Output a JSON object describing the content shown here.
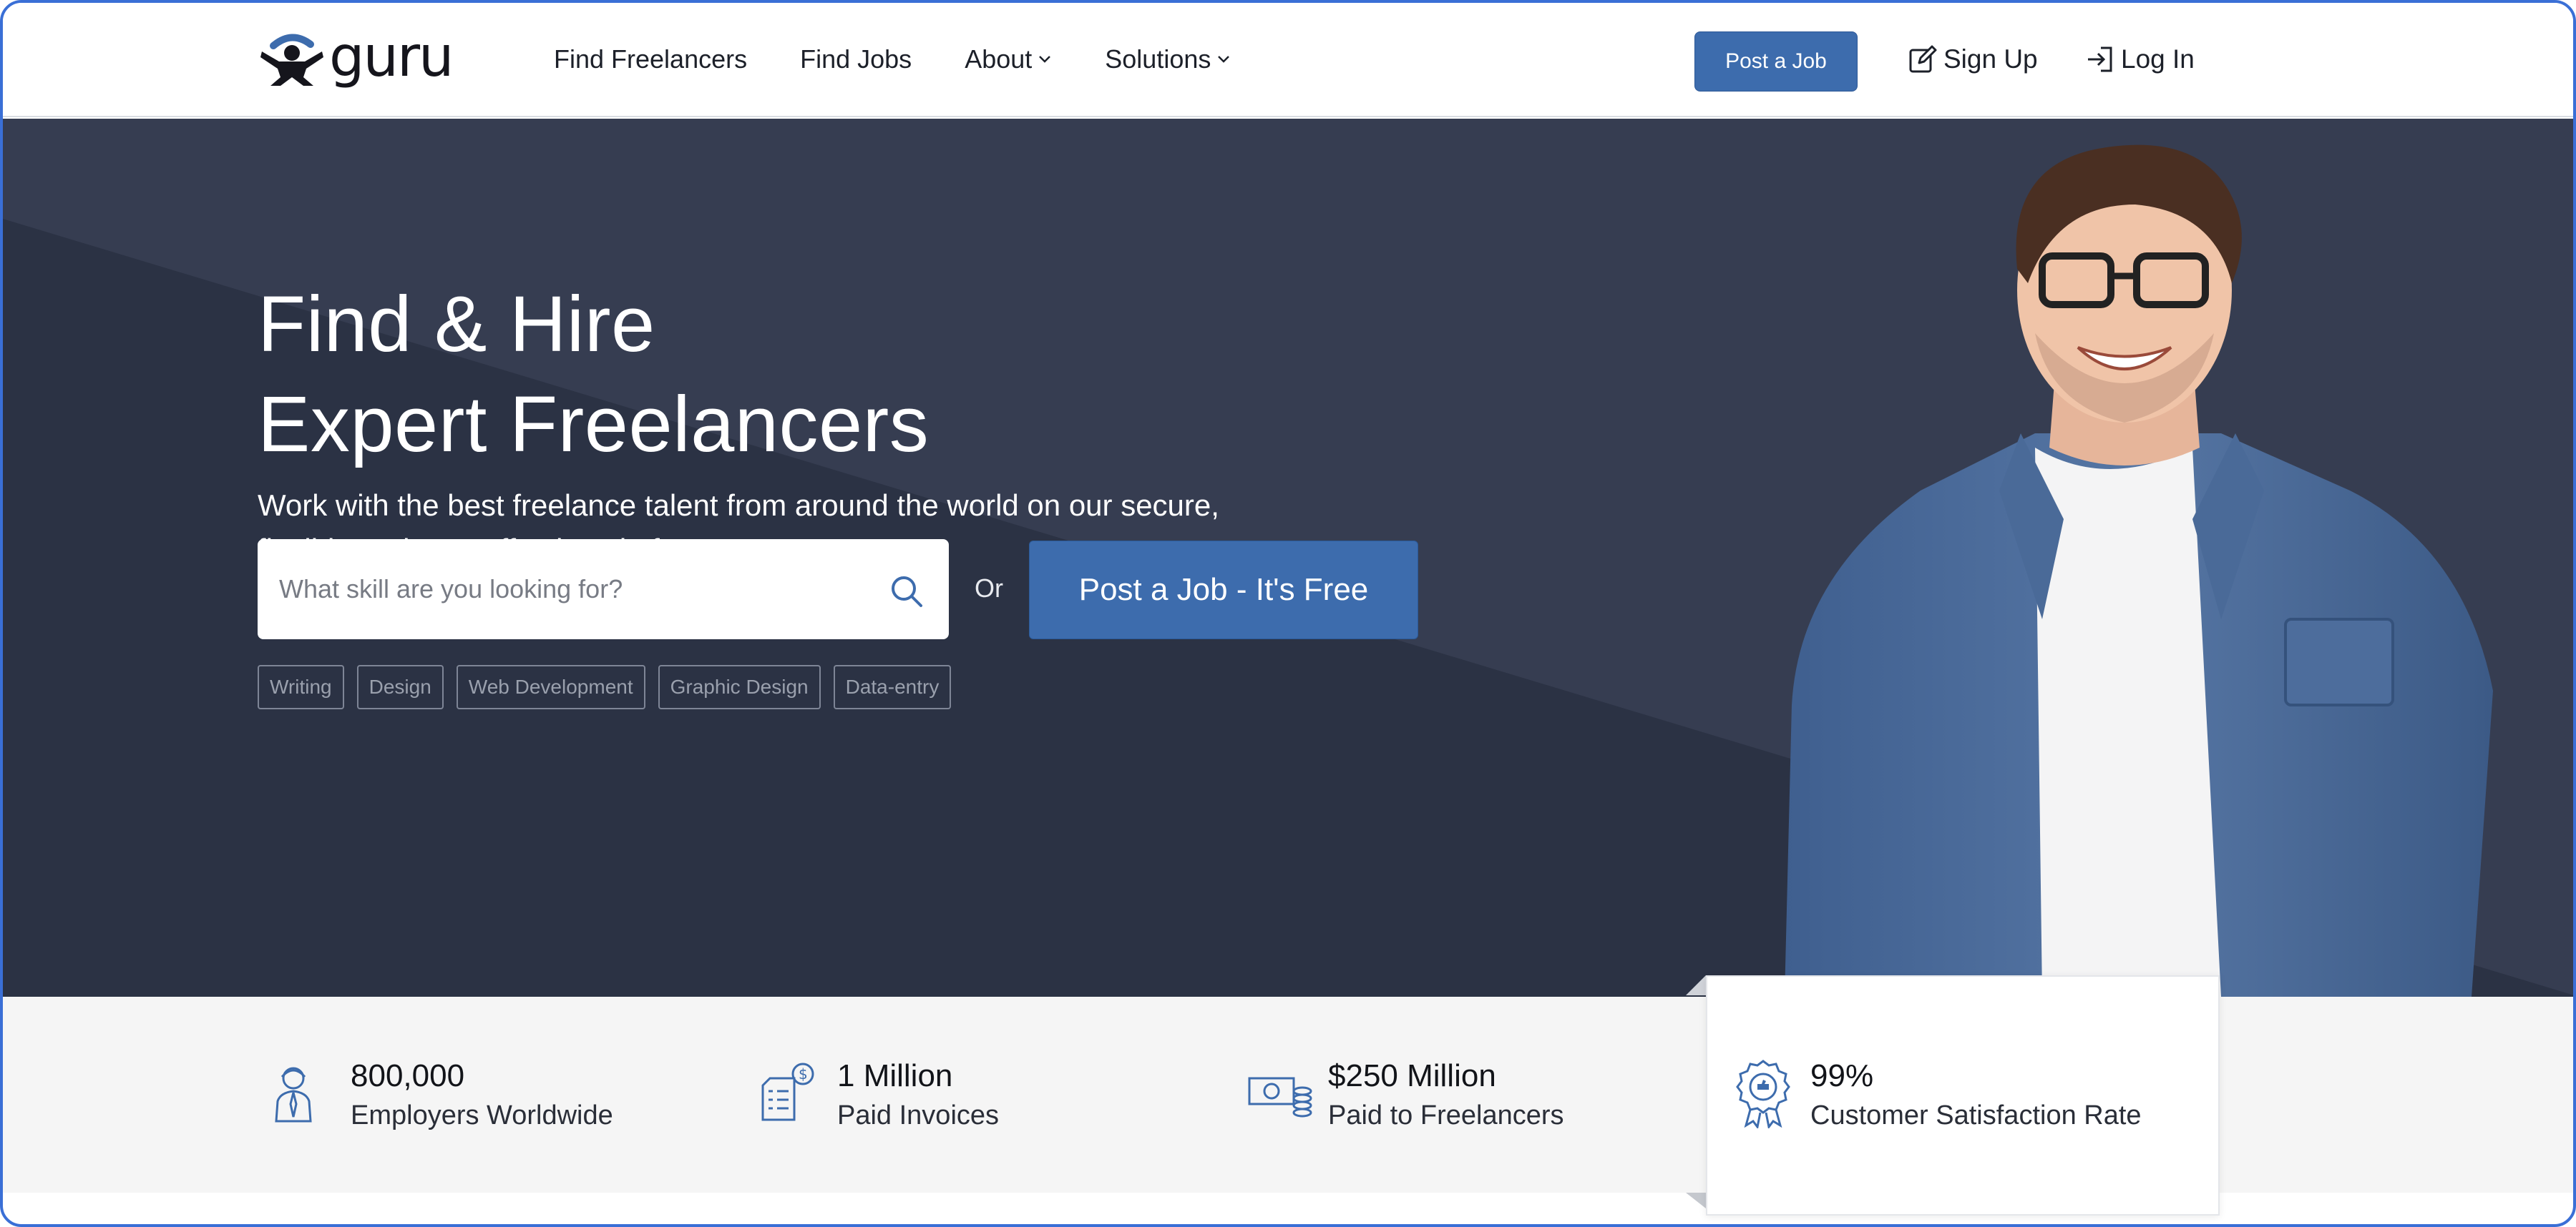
{
  "brand": {
    "logo_text": "guru"
  },
  "nav": {
    "items": [
      {
        "label": "Find Freelancers",
        "has_dropdown": false
      },
      {
        "label": "Find Jobs",
        "has_dropdown": false
      },
      {
        "label": "About",
        "has_dropdown": true
      },
      {
        "label": "Solutions",
        "has_dropdown": true
      }
    ],
    "post_job_label": "Post a Job",
    "signup_label": "Sign Up",
    "login_label": "Log In"
  },
  "hero": {
    "title_line1": "Find & Hire",
    "title_line2": "Expert Freelancers",
    "subtitle_line1": "Work with the best freelance talent from around the world on our secure,",
    "subtitle_line2": "flexible and cost-effective platform.",
    "search": {
      "placeholder": "What skill are you looking for?",
      "value": ""
    },
    "or_label": "Or",
    "cta_label": "Post a Job - It's Free",
    "chips": [
      "Writing",
      "Design",
      "Web Development",
      "Graphic Design",
      "Data-entry"
    ]
  },
  "stats": [
    {
      "icon": "employer-icon",
      "value": "800,000",
      "label": "Employers Worldwide"
    },
    {
      "icon": "invoice-icon",
      "value": "1 Million",
      "label": "Paid Invoices"
    },
    {
      "icon": "money-icon",
      "value": "$250 Million",
      "label": "Paid to Freelancers"
    },
    {
      "icon": "award-ribbon-icon",
      "value": "99%",
      "label": "Customer Satisfaction Rate"
    }
  ],
  "colors": {
    "accent": "#3d6cad",
    "hero_bg": "#363d51",
    "hero_bg_dark": "#2c3345",
    "stats_bg": "#f5f5f5",
    "frame_border": "#3a6fd6"
  }
}
